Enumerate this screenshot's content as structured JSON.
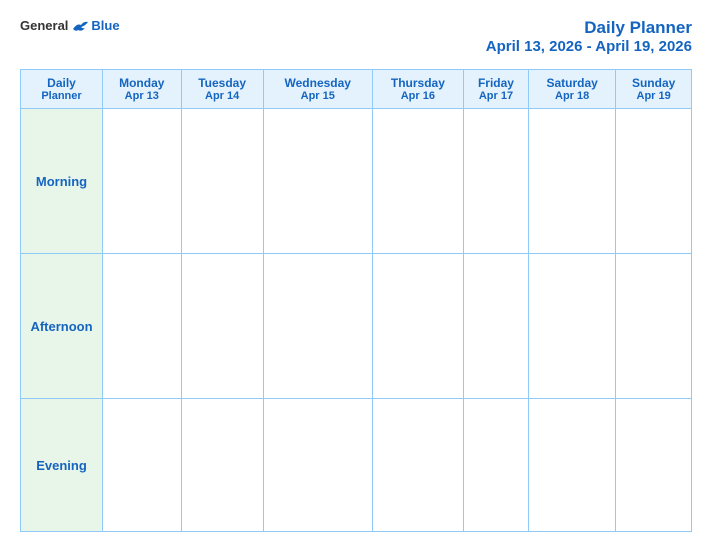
{
  "header": {
    "logo": {
      "general": "General",
      "blue": "Blue"
    },
    "title": "Daily Planner",
    "date_range": "April 13, 2026 - April 19, 2026"
  },
  "table": {
    "first_col": {
      "line1": "Daily",
      "line2": "Planner"
    },
    "days": [
      {
        "name": "Monday",
        "date": "Apr 13"
      },
      {
        "name": "Tuesday",
        "date": "Apr 14"
      },
      {
        "name": "Wednesday",
        "date": "Apr 15"
      },
      {
        "name": "Thursday",
        "date": "Apr 16"
      },
      {
        "name": "Friday",
        "date": "Apr 17"
      },
      {
        "name": "Saturday",
        "date": "Apr 18"
      },
      {
        "name": "Sunday",
        "date": "Apr 19"
      }
    ],
    "rows": [
      {
        "label": "Morning"
      },
      {
        "label": "Afternoon"
      },
      {
        "label": "Evening"
      }
    ]
  }
}
